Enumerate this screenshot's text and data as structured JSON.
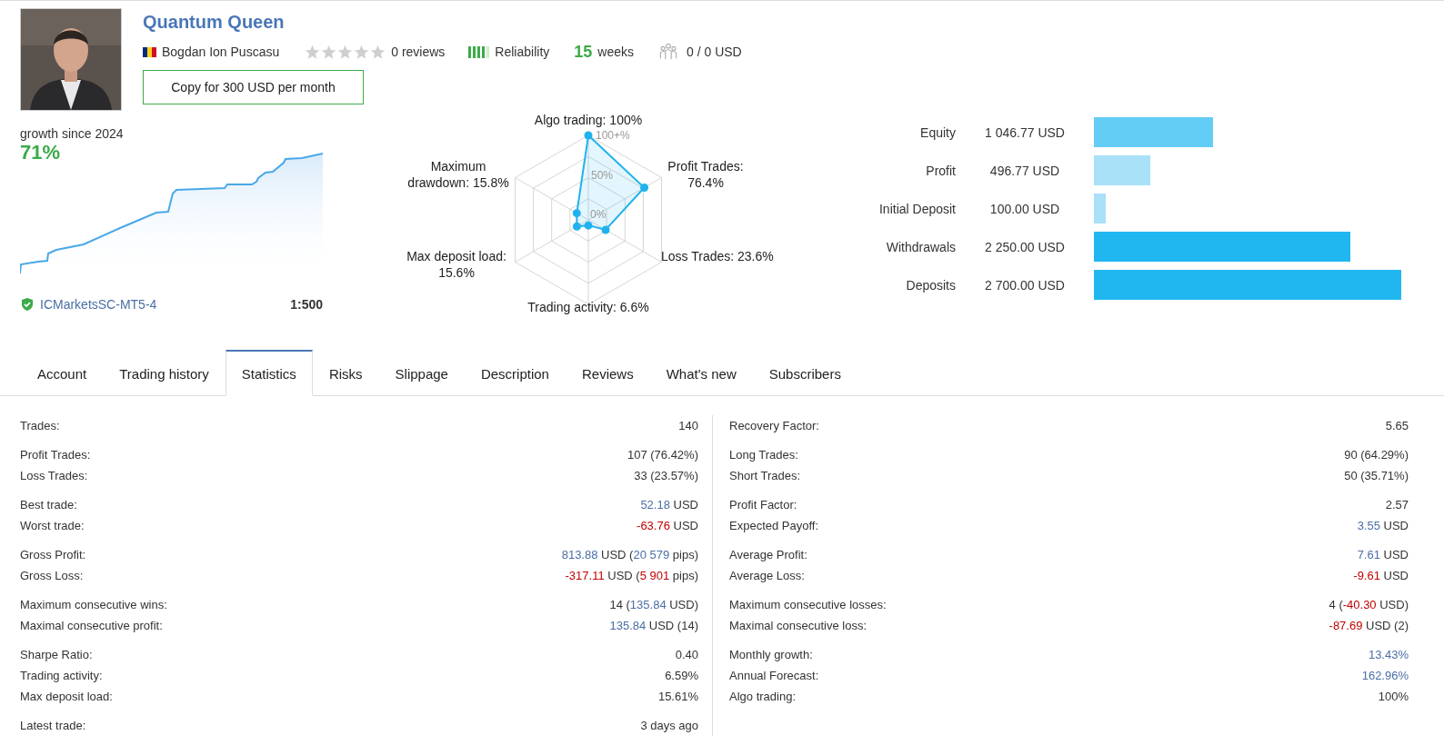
{
  "profile": {
    "title": "Quantum Queen",
    "author": "Bogdan Ion Puscasu",
    "stars": 0,
    "reviews": "0 reviews",
    "reliability": {
      "label": "Reliability",
      "level": 0.8
    },
    "weeks_number": "15",
    "weeks_label": "weeks",
    "subscribers": "0 / 0 USD",
    "copy_button": "Copy for 300 USD per month"
  },
  "growth": {
    "caption": "growth since 2024",
    "value": "71%",
    "broker": "ICMarketsSC-MT5-4",
    "leverage": "1:500"
  },
  "radar": {
    "ticks": [
      "100+%",
      "50%",
      "0%"
    ],
    "axes": [
      {
        "label": "Algo trading: 100%"
      },
      {
        "label": "Maximum drawdown: 15.8%"
      },
      {
        "label": "Profit Trades: 76.4%"
      },
      {
        "label": "Max deposit load: 15.6%"
      },
      {
        "label": "Loss Trades: 23.6%"
      },
      {
        "label": "Trading activity: 6.6%"
      }
    ]
  },
  "balances": [
    {
      "label": "Equity",
      "value": "1 046.77 USD",
      "color": "#63cdf5"
    },
    {
      "label": "Profit",
      "value": "496.77 USD",
      "color": "#a8e1f8"
    },
    {
      "label": "Initial Deposit",
      "value": "100.00 USD",
      "color": "#a8e1f8"
    },
    {
      "label": "Withdrawals",
      "value": "2 250.00 USD",
      "color": "#20b7f0"
    },
    {
      "label": "Deposits",
      "value": "2 700.00 USD",
      "color": "#20b7f0"
    }
  ],
  "tabs": [
    {
      "label": "Account",
      "selected": false
    },
    {
      "label": "Trading history",
      "selected": false
    },
    {
      "label": "Statistics",
      "selected": true
    },
    {
      "label": "Risks",
      "selected": false
    },
    {
      "label": "Slippage",
      "selected": false
    },
    {
      "label": "Description",
      "selected": false
    },
    {
      "label": "Reviews",
      "selected": false
    },
    {
      "label": "What's new",
      "selected": false
    },
    {
      "label": "Subscribers",
      "selected": false
    }
  ],
  "statistics": {
    "left": [
      [
        {
          "label": "Trades:",
          "value": [
            {
              "text": "140",
              "kind": "plain"
            }
          ]
        }
      ],
      [
        {
          "label": "Profit Trades:",
          "value": [
            {
              "text": "107 (76.42%)",
              "kind": "plain"
            }
          ]
        },
        {
          "label": "Loss Trades:",
          "value": [
            {
              "text": "33 (23.57%)",
              "kind": "plain"
            }
          ]
        }
      ],
      [
        {
          "label": "Best trade:",
          "value": [
            {
              "text": "52.18",
              "kind": "pos"
            },
            {
              "text": " USD",
              "kind": "plain"
            }
          ]
        },
        {
          "label": "Worst trade:",
          "value": [
            {
              "text": "-63.76",
              "kind": "neg"
            },
            {
              "text": " USD",
              "kind": "plain"
            }
          ]
        }
      ],
      [
        {
          "label": "Gross Profit:",
          "value": [
            {
              "text": "813.88",
              "kind": "pos"
            },
            {
              "text": " USD (",
              "kind": "plain"
            },
            {
              "text": "20 579",
              "kind": "pos"
            },
            {
              "text": " pips)",
              "kind": "plain"
            }
          ]
        },
        {
          "label": "Gross Loss:",
          "value": [
            {
              "text": "-317.11",
              "kind": "neg"
            },
            {
              "text": " USD (",
              "kind": "plain"
            },
            {
              "text": "5 901",
              "kind": "neg"
            },
            {
              "text": " pips)",
              "kind": "plain"
            }
          ]
        }
      ],
      [
        {
          "label": "Maximum consecutive wins:",
          "value": [
            {
              "text": "14 (",
              "kind": "plain"
            },
            {
              "text": "135.84",
              "kind": "pos"
            },
            {
              "text": " USD)",
              "kind": "plain"
            }
          ]
        },
        {
          "label": "Maximal consecutive profit:",
          "value": [
            {
              "text": "135.84",
              "kind": "pos"
            },
            {
              "text": " USD (14)",
              "kind": "plain"
            }
          ]
        }
      ],
      [
        {
          "label": "Sharpe Ratio:",
          "value": [
            {
              "text": "0.40",
              "kind": "plain"
            }
          ]
        },
        {
          "label": "Trading activity:",
          "value": [
            {
              "text": "6.59%",
              "kind": "plain"
            }
          ]
        },
        {
          "label": "Max deposit load:",
          "value": [
            {
              "text": "15.61%",
              "kind": "plain"
            }
          ]
        }
      ],
      [
        {
          "label": "Latest trade:",
          "value": [
            {
              "text": "3 days ago",
              "kind": "plain"
            }
          ]
        }
      ]
    ],
    "right": [
      [
        {
          "label": "Recovery Factor:",
          "value": [
            {
              "text": "5.65",
              "kind": "plain"
            }
          ]
        }
      ],
      [
        {
          "label": "Long Trades:",
          "value": [
            {
              "text": "90 (64.29%)",
              "kind": "plain"
            }
          ]
        },
        {
          "label": "Short Trades:",
          "value": [
            {
              "text": "50 (35.71%)",
              "kind": "plain"
            }
          ]
        }
      ],
      [
        {
          "label": "Profit Factor:",
          "value": [
            {
              "text": "2.57",
              "kind": "plain"
            }
          ]
        },
        {
          "label": "Expected Payoff:",
          "value": [
            {
              "text": "3.55",
              "kind": "pos"
            },
            {
              "text": " USD",
              "kind": "plain"
            }
          ]
        }
      ],
      [
        {
          "label": "Average Profit:",
          "value": [
            {
              "text": "7.61",
              "kind": "pos"
            },
            {
              "text": " USD",
              "kind": "plain"
            }
          ]
        },
        {
          "label": "Average Loss:",
          "value": [
            {
              "text": "-9.61",
              "kind": "neg"
            },
            {
              "text": " USD",
              "kind": "plain"
            }
          ]
        }
      ],
      [
        {
          "label": "Maximum consecutive losses:",
          "value": [
            {
              "text": "4 (",
              "kind": "plain"
            },
            {
              "text": "-40.30",
              "kind": "neg"
            },
            {
              "text": " USD)",
              "kind": "plain"
            }
          ]
        },
        {
          "label": "Maximal consecutive loss:",
          "value": [
            {
              "text": "-87.69",
              "kind": "neg"
            },
            {
              "text": " USD (2)",
              "kind": "plain"
            }
          ]
        }
      ],
      [
        {
          "label": "Monthly growth:",
          "value": [
            {
              "text": "13.43%",
              "kind": "pos"
            }
          ]
        },
        {
          "label": "Annual Forecast:",
          "value": [
            {
              "text": "162.96%",
              "kind": "pos"
            }
          ]
        },
        {
          "label": "Algo trading:",
          "value": [
            {
              "text": "100%",
              "kind": "plain"
            }
          ]
        }
      ]
    ]
  }
}
